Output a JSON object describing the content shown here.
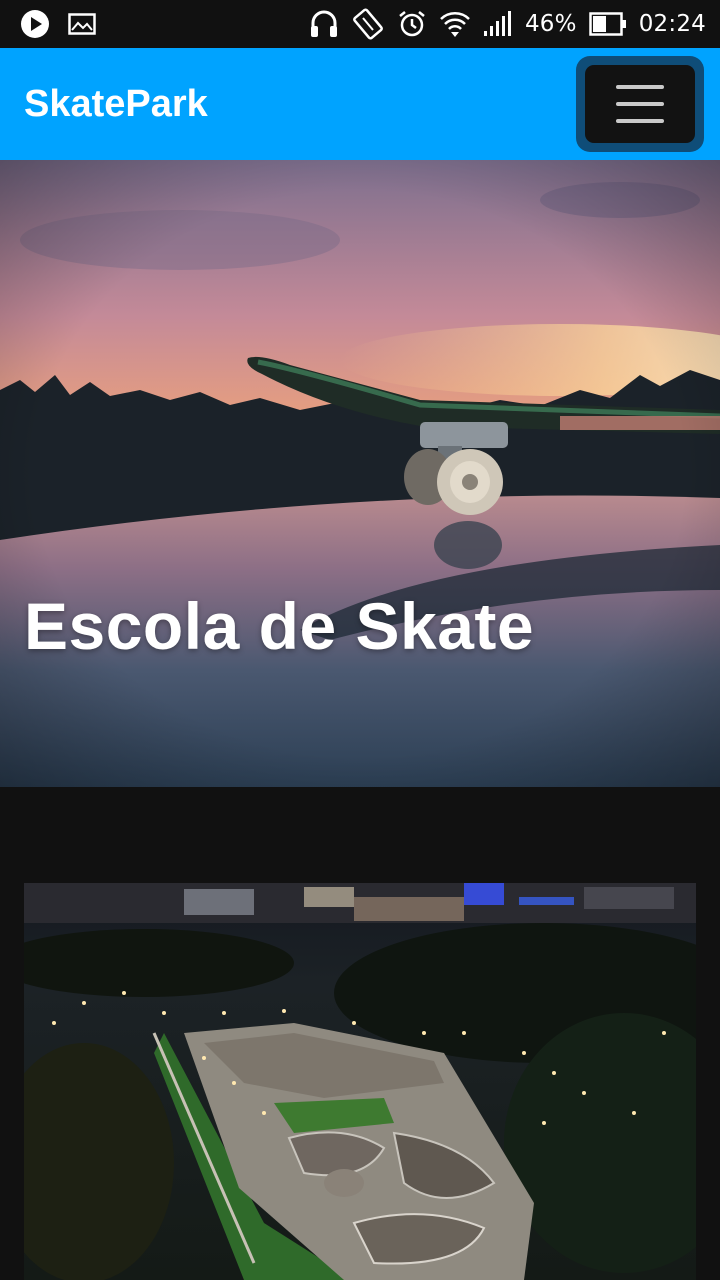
{
  "status_bar": {
    "battery_percent": "46%",
    "time": "02:24",
    "icons": [
      "play-icon",
      "image-icon",
      "headphones-icon",
      "rotate-icon",
      "alarm-icon",
      "wifi-icon",
      "signal-icon",
      "battery-icon"
    ]
  },
  "app_bar": {
    "brand": "SkatePark",
    "menu_icon": "hamburger-menu-icon",
    "color": "#00a3ff"
  },
  "hero": {
    "title": "Escola de Skate",
    "image": "skateboard-sunset-photo"
  },
  "content": {
    "image": "skatepark-aerial-night-photo"
  }
}
